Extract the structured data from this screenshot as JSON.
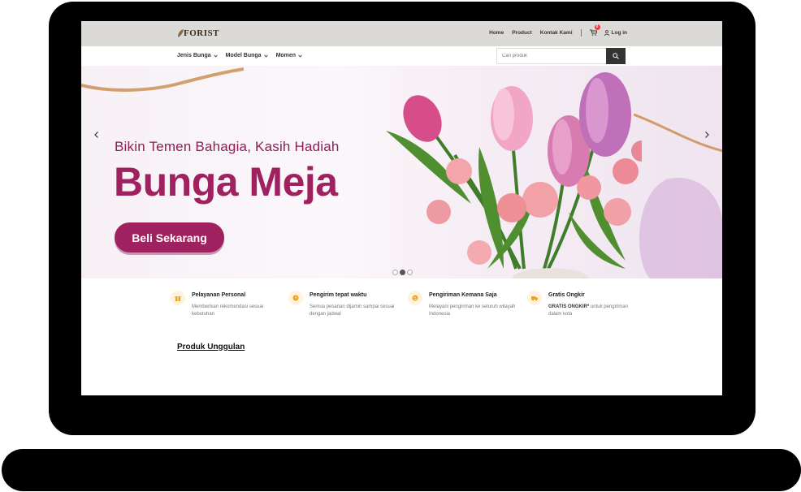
{
  "header": {
    "logo_text": "FORIST",
    "nav": [
      "Home",
      "Product",
      "Kontak Kami"
    ],
    "cart_count": "0",
    "login_label": "Log in"
  },
  "menu": {
    "items": [
      "Jenis Bunga",
      "Model Bunga",
      "Momen"
    ]
  },
  "search": {
    "placeholder": "Cari produk"
  },
  "hero": {
    "subtitle": "Bikin Temen Bahagia, Kasih Hadiah",
    "title": "Bunga Meja",
    "button_label": "Beli Sekarang",
    "slide_count": 3,
    "active_slide": 2
  },
  "features": [
    {
      "title": "Pelayanan Personal",
      "desc": "Memberikan rekomendasi sesuai kebutuhan",
      "icon": "gift-icon"
    },
    {
      "title": "Pengirim tepat waktu",
      "desc": "Semua pesanan dijamin sampai sesuai dengan jadwal",
      "icon": "clock-icon"
    },
    {
      "title": "Pengiriman Kemana Saja",
      "desc": "Melayani pengiriman ke seluruh wilayah Indonesia",
      "icon": "globe-icon"
    },
    {
      "title": "Gratis Ongkir",
      "desc_bold": "GRATIS ONGKIR*",
      "desc": " untuk pengiriman dalam kota",
      "icon": "truck-icon"
    }
  ],
  "section": {
    "title": "Produk Unggulan"
  },
  "colors": {
    "accent": "#a0215f",
    "icon_color": "#f0a31c",
    "topbar": "#dcdad6"
  }
}
